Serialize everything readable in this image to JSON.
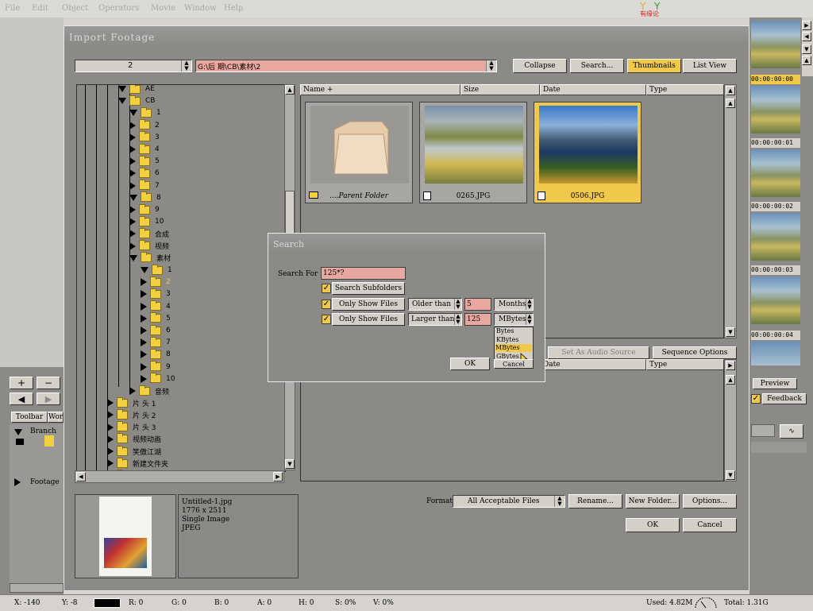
{
  "menu": [
    "File",
    "Edit",
    "Object",
    "Operators",
    "Movie",
    "Window",
    "Help"
  ],
  "brand": "有缘论",
  "dialog": {
    "title": "Import Footage",
    "folder_combo": "2",
    "path": "G:\\后 期\\CB\\素材\\2",
    "buttons": {
      "collapse": "Collapse",
      "search": "Search...",
      "thumbnails": "Thumbnails",
      "list_view": "List View"
    },
    "columns": {
      "name": "Name +",
      "size": "Size",
      "date": "Date",
      "type": "Type"
    },
    "thumbs": [
      {
        "caption": "....Parent Folder"
      },
      {
        "caption": "0265.JPG"
      },
      {
        "caption": "0506.JPG"
      }
    ],
    "lower_tabs": {
      "audio": "Set As Audio Source",
      "sequence": "Sequence Options"
    },
    "lower_cols": {
      "date": "Date",
      "type": "Type"
    },
    "preview_info": [
      "Untitled-1.jpg",
      "1776 x 2511",
      "Single Image",
      "JPEG"
    ],
    "format_label": "Format",
    "format_value": "All Acceptable Files",
    "rename": "Rename...",
    "new_folder": "New Folder...",
    "options": "Options...",
    "ok": "OK",
    "cancel": "Cancel"
  },
  "tree": [
    {
      "label": "AE",
      "indent": 4,
      "dir": "down"
    },
    {
      "label": "CB",
      "indent": 4,
      "dir": "down"
    },
    {
      "label": "1",
      "indent": 5,
      "dir": "down"
    },
    {
      "label": "2",
      "indent": 5,
      "dir": "right"
    },
    {
      "label": "3",
      "indent": 5,
      "dir": "right"
    },
    {
      "label": "4",
      "indent": 5,
      "dir": "right"
    },
    {
      "label": "5",
      "indent": 5,
      "dir": "right"
    },
    {
      "label": "6",
      "indent": 5,
      "dir": "right"
    },
    {
      "label": "7",
      "indent": 5,
      "dir": "right"
    },
    {
      "label": "8",
      "indent": 5,
      "dir": "down"
    },
    {
      "label": "9",
      "indent": 5,
      "dir": "right"
    },
    {
      "label": "10",
      "indent": 5,
      "dir": "right"
    },
    {
      "label": "合成",
      "indent": 5,
      "dir": "right"
    },
    {
      "label": "视频",
      "indent": 5,
      "dir": "right"
    },
    {
      "label": "素材",
      "indent": 5,
      "dir": "down"
    },
    {
      "label": "1",
      "indent": 6,
      "dir": "down"
    },
    {
      "label": "2",
      "indent": 6,
      "dir": "right",
      "sel": true
    },
    {
      "label": "3",
      "indent": 6,
      "dir": "right"
    },
    {
      "label": "4",
      "indent": 6,
      "dir": "right"
    },
    {
      "label": "5",
      "indent": 6,
      "dir": "right"
    },
    {
      "label": "6",
      "indent": 6,
      "dir": "right"
    },
    {
      "label": "7",
      "indent": 6,
      "dir": "right"
    },
    {
      "label": "8",
      "indent": 6,
      "dir": "right"
    },
    {
      "label": "9",
      "indent": 6,
      "dir": "right"
    },
    {
      "label": "10",
      "indent": 6,
      "dir": "right"
    },
    {
      "label": "音频",
      "indent": 5,
      "dir": "right"
    },
    {
      "label": "片 头 1",
      "indent": 3,
      "dir": "right"
    },
    {
      "label": "片 头 2",
      "indent": 3,
      "dir": "right"
    },
    {
      "label": "片 头 3",
      "indent": 3,
      "dir": "right"
    },
    {
      "label": "视频动画",
      "indent": 3,
      "dir": "right"
    },
    {
      "label": "笑傲江湖",
      "indent": 3,
      "dir": "right"
    },
    {
      "label": "新建文件夹",
      "indent": 3,
      "dir": "right"
    },
    {
      "label": "音频",
      "indent": 3,
      "dir": "right"
    }
  ],
  "search": {
    "title": "Search",
    "search_for_label": "Search For",
    "search_for_value": "125*?",
    "subfolders": "Search Subfolders",
    "only_show_1": "Only Show Files",
    "older_than": "Older than",
    "older_value": "5",
    "months": "Months",
    "only_show_2": "Only Show Files",
    "larger_than": "Larger than",
    "larger_value": "125",
    "unit": "MBytes",
    "unit_options": [
      "Bytes",
      "KBytes",
      "MBytes",
      "GBytes"
    ],
    "ok": "OK",
    "cancel": "Cancel"
  },
  "left_panel": {
    "plus": "+",
    "minus": "−",
    "toolbar_tab": "Toolbar",
    "wor_tab": "Wor",
    "branch": "Branch",
    "footage": "Footage"
  },
  "right_panel": {
    "timecodes": [
      "00:00:00:00",
      "00:00:00:01",
      "00:00:00:02",
      "00:00:00:03",
      "00:00:00:04"
    ],
    "preview": "Preview",
    "feedback": "Feedback"
  },
  "status": {
    "x": "X: -140",
    "y": "Y: -8",
    "r": "R: 0",
    "g": "G: 0",
    "b": "B: 0",
    "a": "A: 0",
    "h": "H: 0",
    "s": "S: 0%",
    "v": "V: 0%",
    "used": "Used: 4.82M",
    "total": "Total: 1.31G"
  }
}
